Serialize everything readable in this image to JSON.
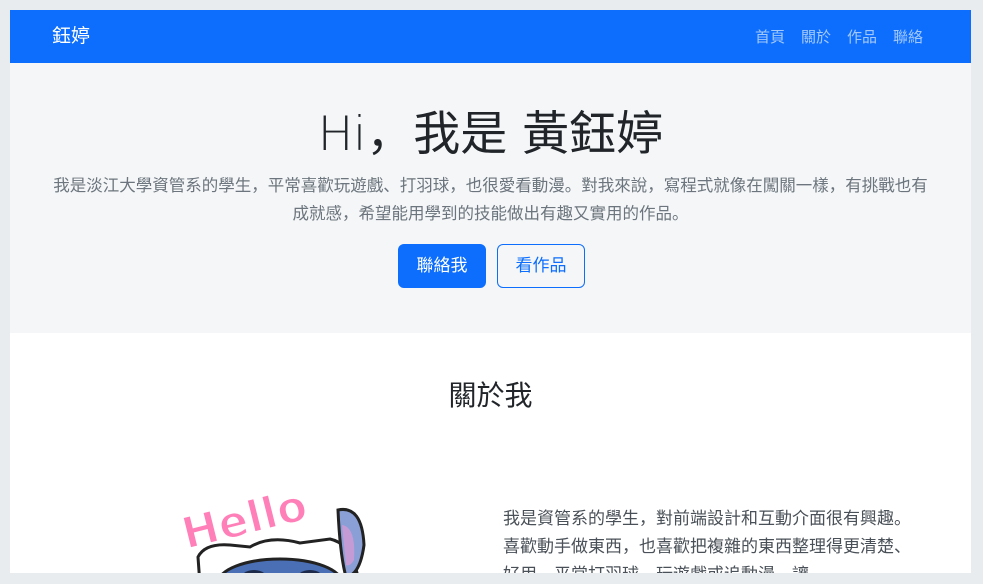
{
  "navbar": {
    "brand": "鈺婷",
    "links": [
      "首頁",
      "關於",
      "作品",
      "聯絡"
    ]
  },
  "hero": {
    "title": "Hi，我是 黃鈺婷",
    "description": "我是淡江大學資管系的學生，平常喜歡玩遊戲、打羽球，也很愛看動漫。對我來說，寫程式就像在闖關一樣，有挑戰也有成就感，希望能用學到的技能做出有趣又實用的作品。",
    "primary_button": "聯絡我",
    "secondary_button": "看作品"
  },
  "about": {
    "title": "關於我",
    "sticker_text": "Hello",
    "text": "我是資管系的學生，對前端設計和互動介面很有興趣。喜歡動手做東西，也喜歡把複雜的東西整理得更清楚、好用。平常打羽球、玩遊戲或追動漫，讓"
  },
  "colors": {
    "primary": "#0d6efd",
    "hero_bg": "#f4f6f8",
    "page_bg": "#e9ecef"
  }
}
